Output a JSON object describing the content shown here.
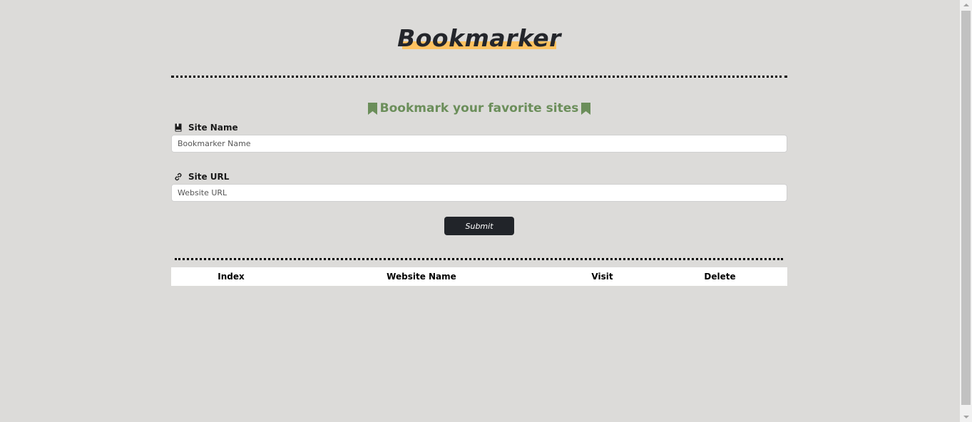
{
  "header": {
    "logo_text": "Bookmarker",
    "accent_color": "#fec260"
  },
  "form": {
    "heading": "Bookmark your favorite sites",
    "heading_color": "#6b8e5a",
    "heading_icon": "bookmark-icon",
    "site_name": {
      "label": "Site Name",
      "icon": "book-icon",
      "placeholder": "Bookmarker Name",
      "value": ""
    },
    "site_url": {
      "label": "Site URL",
      "icon": "link-icon",
      "placeholder": "Website URL",
      "value": ""
    },
    "submit_label": "Submit"
  },
  "table": {
    "columns": [
      "Index",
      "Website Name",
      "Visit",
      "Delete"
    ],
    "rows": []
  }
}
